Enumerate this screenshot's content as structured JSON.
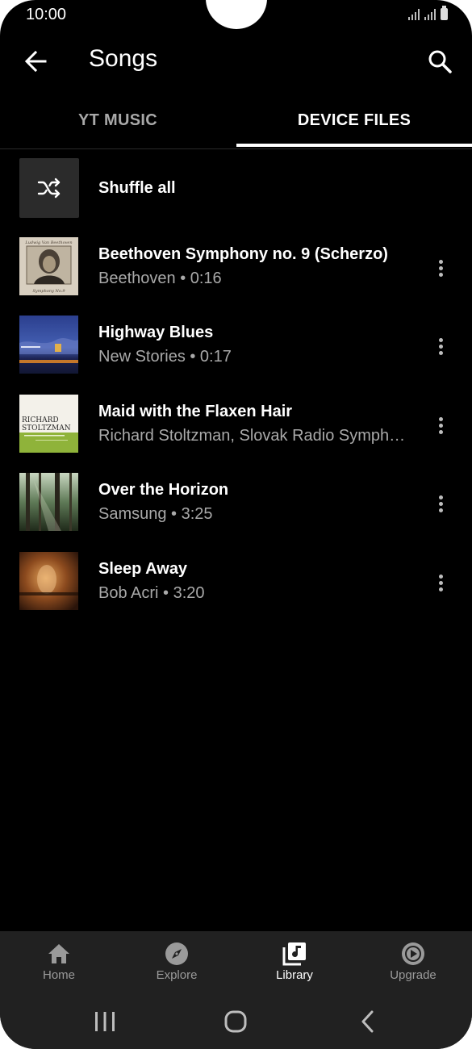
{
  "status": {
    "time": "10:00"
  },
  "appbar": {
    "title": "Songs"
  },
  "tabs": [
    {
      "label": "YT MUSIC",
      "selected": false
    },
    {
      "label": "DEVICE FILES",
      "selected": true
    }
  ],
  "shuffle": {
    "label": "Shuffle all"
  },
  "songs": [
    {
      "title": "Beethoven Symphony no. 9 (Scherzo)",
      "subtitle": "Beethoven • 0:16"
    },
    {
      "title": "Highway Blues",
      "subtitle": "New Stories • 0:17"
    },
    {
      "title": "Maid with the Flaxen Hair",
      "subtitle": "Richard Stoltzman, Slovak Radio Symph…"
    },
    {
      "title": "Over the Horizon",
      "subtitle": "Samsung • 3:25"
    },
    {
      "title": "Sleep Away",
      "subtitle": "Bob Acri • 3:20"
    }
  ],
  "bottom_nav": [
    {
      "label": "Home",
      "icon": "home-icon"
    },
    {
      "label": "Explore",
      "icon": "compass-icon"
    },
    {
      "label": "Library",
      "icon": "library-music-icon",
      "active": true
    },
    {
      "label": "Upgrade",
      "icon": "upgrade-play-icon"
    }
  ],
  "art_text": {
    "beethoven_top": "Ludwig Van Beethoven",
    "beethoven_bottom": "Symphony No.9",
    "richard_line1": "RICHARD",
    "richard_line2": "STOLTZMAN"
  },
  "colors": {
    "background": "#000000",
    "nav_bg": "#212121",
    "muted_text": "#a9a9a9"
  }
}
